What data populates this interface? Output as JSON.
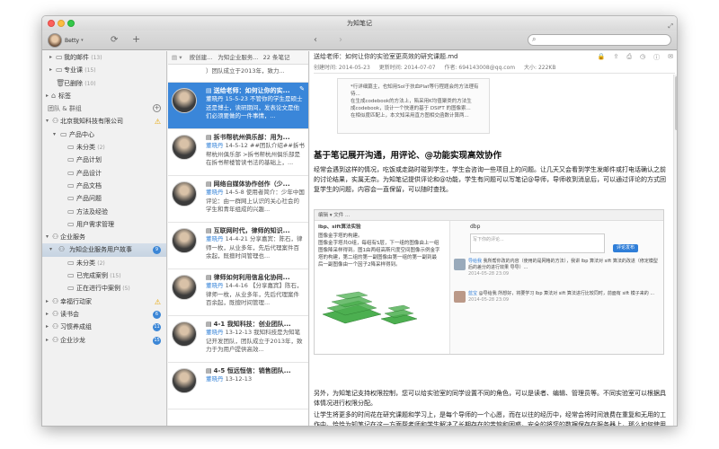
{
  "window": {
    "title": "为知笔记"
  },
  "toolbar": {
    "username": "Betty",
    "search_placeholder": ""
  },
  "sidebar": {
    "items": [
      {
        "label": "我的邮件",
        "count": "(13)"
      },
      {
        "label": "专业课",
        "count": "(15)"
      },
      {
        "label": "已删除",
        "count": "(10)"
      },
      {
        "label": "标签",
        "count": ""
      },
      {
        "label": "团队 & 群组",
        "count": ""
      },
      {
        "label": "北京我知科技有限公司",
        "count": ""
      },
      {
        "label": "产品中心",
        "count": ""
      },
      {
        "label": "未分类",
        "count": "(2)"
      },
      {
        "label": "产品计划",
        "count": ""
      },
      {
        "label": "产品设计",
        "count": ""
      },
      {
        "label": "产品文档",
        "count": ""
      },
      {
        "label": "产品问题",
        "count": ""
      },
      {
        "label": "方法及经验",
        "count": ""
      },
      {
        "label": "用户需求管理",
        "count": ""
      },
      {
        "label": "企业服务",
        "count": ""
      },
      {
        "label": "为知企业服务用户故事",
        "count": "",
        "badge": "9"
      },
      {
        "label": "未分类",
        "count": "(2)"
      },
      {
        "label": "已完成案例",
        "count": "(15)"
      },
      {
        "label": "正在进行中案例",
        "count": "(5)"
      },
      {
        "label": "幸福行动家",
        "count": ""
      },
      {
        "label": "读书会",
        "count": "",
        "badge": "6"
      },
      {
        "label": "习惯养成组",
        "count": "",
        "badge": "11"
      },
      {
        "label": "企业沙龙",
        "count": "",
        "badge": "15"
      }
    ]
  },
  "notelist": {
    "sort_label": "按创建...",
    "folder_label": "为知企业服务...",
    "count_label": "22 条笔记",
    "notes": [
      {
        "title": "",
        "body": "）团队成立于2013年，致力..."
      },
      {
        "title": "送给老师：如何让你的实...",
        "author": "董晓丹",
        "date": "15-5-23",
        "body": "不管你的学生是硕士还是博士，读研期间，发表论文是他们必须要做的一件事情，..."
      },
      {
        "title": "拆书帮杭州俱乐部：用为...",
        "author": "董晓丹",
        "date": "14-5-12",
        "body": "##团队介绍##拆书帮杭州俱乐部 >拆书帮杭州俱乐部是在拆书帮楼管读书法的基础上，..."
      },
      {
        "title": "网络自媒体协作创作（少...",
        "author": "董晓丹",
        "date": "14-5-8",
        "body": "使用者简介：少年中国评论：由一群网上认识的关心社会的学生和青年组成的兴趣..."
      },
      {
        "title": "互联网时代，律师的知识...",
        "author": "董晓丹",
        "date": "14-4-21",
        "body": "分享嘉宾：陈石，律师一枚，从业多年，先后代理案件百余起，既擅时间管理也..."
      },
      {
        "title": "律师如何利用信息化协同...",
        "author": "董晓丹",
        "date": "14-4-16",
        "body": "【分享嘉宾】陈石，律师一枚，从业多年，先后代理案件百余起，既擅时间管理..."
      },
      {
        "title": "4-1 我知科技：创业团队...",
        "author": "董晓丹",
        "date": "13-12-13",
        "body": "我知科技是为知笔记开发团队，团队成立于2013年，致力于为用户提供高效..."
      },
      {
        "title": "4-5 恒远恒信：销售团队...",
        "author": "董晓丹",
        "date": "13-12-13",
        "body": ""
      }
    ]
  },
  "content": {
    "title": "送给老师：如何让你的实验室更高效的研究课题.md",
    "created": "创建时间: 2014-05-23",
    "updated": "更新时间: 2014-07-07",
    "author": "作者: 694143008@qq.com",
    "size": "大小: 222KB",
    "img1_lines": [
      "*行详细篇主，也知用Sol于扶血Plat等行程题会的方法理有待...",
      "在生成codebook的方法上，陷采用K均值聚类的方法生",
      "成codebook，设计一个快速的基于 DSIFT 的图像索...",
      "在相似度匹配上，本文知采用直方图相交函数计算两..."
    ],
    "heading": "基于笔记展开沟通，用评论、@功能实现高效协作",
    "para1": "经常会遇到这样的情况，吃饭或走路时碰到学生，学生会咨询一些项目上的问题。让几天又会看到学生发邮件或打电话确认之前的讨论结果，实属无奈。为知笔记提供评论和@功能，学生有问题可以写笔记@导师，导师收到消息后，可以通过评论的方式回复学生的问题，内容会一直保留，可以随时查找。",
    "shot": {
      "toolbar": "编辑  ▾   文件   ...",
      "left_title": "lbp、sift算法实验",
      "left_lines": [
        "图像金字塔的构建。",
        "图像金字塔共O组，每组有S层，下一组的图像由上一组",
        "图像降采样得到。图1由两组高斯尺度空间图像示例金字",
        "塔的构建，第二组的第一副图像由第一组的第一副到最",
        "后一副图像由一个因子2降采样得到。"
      ],
      "chat_title": "dbp",
      "chat_input": "写下你的评论...",
      "send_label": "评论发布",
      "chat_rows": [
        {
          "name": "导给我",
          "text": "我所帮你改的内容（使用的是网格的方法），我讲 lbp 算法对 sift 算法的改进（修定模型后的差分的进行效果 导导）...",
          "time": "2014-05-28 23:09"
        },
        {
          "name": "蓝宝",
          "text": "@导给我 所想好，将要学习 lbp 算法对 sift 算法进行比较同时，前面有 sift 模子来的 ...",
          "time": "2014-05-28 23:09"
        }
      ]
    },
    "para2": "另外，为知笔记支持权限控制，您可以给实验室的同学设置不同的角色，可以是读者、编辑、管理员等。不同实验室可以根据具体情况进行权限分配。",
    "para3": "让学生将更多的时间花在研究课题和学习上，是每个导师的一个心愿，而在以往的经历中，经常会将时间浪费在重复和无用的工作中。恰恰为知笔记在这一方面帮老师和学生解决了长期存在的苦恼和困惑，安全的将您的数据保存在服务器上，那么如何使用为知笔记呢？简单几步，就可以快速用起来啦！"
  }
}
